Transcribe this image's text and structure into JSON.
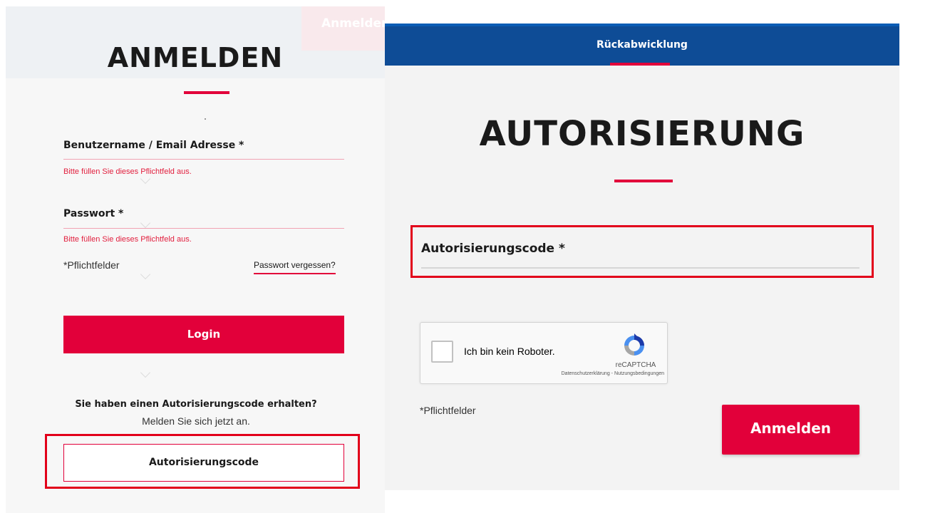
{
  "left_panel": {
    "ghost_button_label": "Anmelden",
    "title": "ANMELDEN",
    "username": {
      "label": "Benutzername / Email Adresse *",
      "error": "Bitte füllen Sie dieses Pflichtfeld aus."
    },
    "password": {
      "label": "Passwort *",
      "error": "Bitte füllen Sie dieses Pflichtfeld aus."
    },
    "required_note": "*Pflichtfelder",
    "forgot_link": "Passwort vergessen?",
    "login_button": "Login",
    "question": "Sie haben einen Autorisierungscode erhalten?",
    "question_sub": "Melden Sie sich jetzt an.",
    "code_button": "Autorisierungscode"
  },
  "right_panel": {
    "tab_label": "Rückabwicklung",
    "title": "AUTORISIERUNG",
    "auth_field_label": "Autorisierungscode *",
    "captcha": {
      "checkbox_label": "Ich bin kein Roboter.",
      "brand": "reCAPTCHA",
      "links": "Datenschutzerklärung - Nutzungsbedingungen"
    },
    "required_note": "*Pflichtfelder",
    "submit_button": "Anmelden"
  },
  "colors": {
    "accent_red": "#e2003a",
    "highlight_red": "#e2001a",
    "nav_blue": "#0e4c96"
  }
}
